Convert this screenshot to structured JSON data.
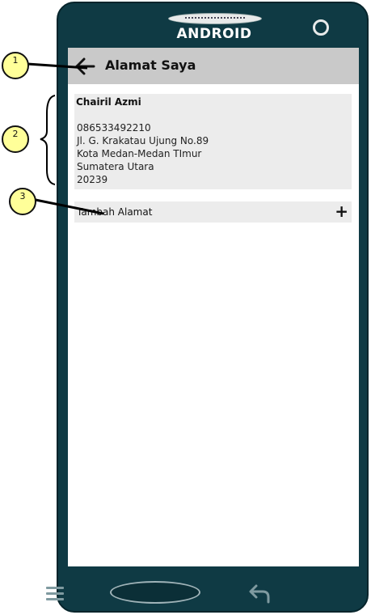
{
  "device": {
    "brand": "ANDROID"
  },
  "topbar": {
    "title": "Alamat Saya",
    "back_icon": "arrow-left-icon"
  },
  "address": {
    "name": "Chairil Azmi",
    "lines": [
      "086533492210",
      "Jl. G. Krakatau Ujung No.89",
      "Kota Medan-Medan TImur",
      "Sumatera Utara",
      "20239"
    ]
  },
  "add_address": {
    "label": "Tambah Alamat",
    "icon": "plus-icon"
  },
  "annotations": [
    "1",
    "2",
    "3"
  ],
  "colors": {
    "phone_body": "#0f3a44",
    "topbar": "#c9c9c9",
    "card": "#ececec",
    "callout": "#ffff99"
  }
}
